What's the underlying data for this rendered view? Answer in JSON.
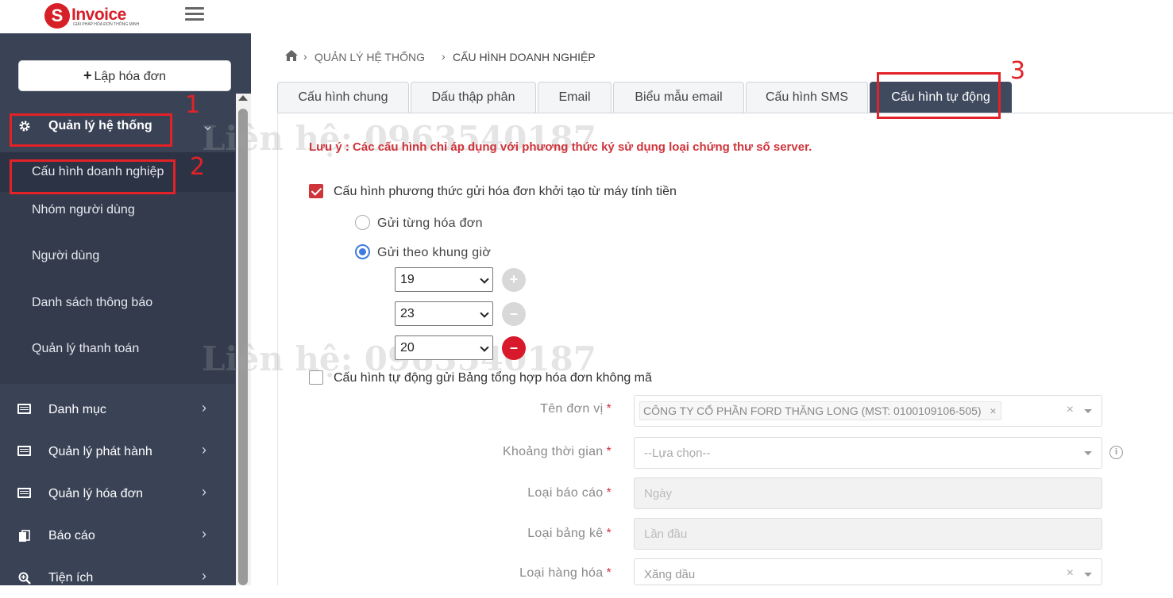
{
  "app": {
    "logo_letter": "S",
    "logo_word": "Invoice",
    "logo_tagline": "GIẢI PHÁP HÓA ĐƠN THÔNG MINH"
  },
  "sidebar": {
    "new_invoice_label": "Lập hóa đơn",
    "system_group": {
      "label": "Quản lý hệ thống",
      "items": [
        {
          "label": "Cấu hình doanh nghiệp"
        },
        {
          "label": "Nhóm người dùng"
        },
        {
          "label": "Người dùng"
        },
        {
          "label": "Danh sách thông báo"
        },
        {
          "label": "Quản lý thanh toán"
        }
      ]
    },
    "groups": [
      {
        "label": "Danh mục"
      },
      {
        "label": "Quản lý phát hành"
      },
      {
        "label": "Quản lý hóa đơn"
      },
      {
        "label": "Báo cáo"
      },
      {
        "label": "Tiện ích"
      }
    ]
  },
  "breadcrumb": {
    "level1": "QUẢN LÝ HỆ THỐNG",
    "level2": "CẤU HÌNH DOANH NGHIỆP"
  },
  "tabs": [
    {
      "label": "Cấu hình chung"
    },
    {
      "label": "Dấu thập phân"
    },
    {
      "label": "Email"
    },
    {
      "label": "Biểu mẫu email"
    },
    {
      "label": "Cấu hình SMS"
    },
    {
      "label": "Cấu hình tự động",
      "active": true
    }
  ],
  "annotations": [
    "1",
    "2",
    "3"
  ],
  "watermark": "Liên hệ: 0963540187",
  "form": {
    "note": "Lưu ý : Các cấu hình chỉ áp dụng với phương thức ký sử dụng loại chứng thư số server.",
    "pos_config_label": "Cấu hình phương thức gửi hóa đơn khởi tạo từ máy tính tiền",
    "pos_config_checked": true,
    "radio_each": "Gửi từng hóa đơn",
    "radio_timeframe": "Gửi theo khung giờ",
    "selected_radio": "timeframe",
    "hours": [
      "19",
      "23",
      "20"
    ],
    "auto_summary_label": "Cấu hình tự động gửi Bảng tổng hợp hóa đơn không mã",
    "auto_summary_checked": false,
    "unit_label": "Tên đơn vị",
    "unit_value": "CÔNG TY CỔ PHẦN FORD THĂNG LONG (MST: 0100109106-505)",
    "period_label": "Khoảng thời gian",
    "period_placeholder": "--Lựa chọn--",
    "report_type_label": "Loại báo cáo",
    "report_type_value": "Ngày",
    "list_type_label": "Loại bảng kê",
    "list_type_value": "Lần đầu",
    "goods_type_label": "Loại hàng hóa",
    "goods_type_value": "Xăng dầu",
    "required_mark": "*"
  },
  "colors": {
    "sidebar_bg": "#3a4356",
    "accent_red": "#d0343b",
    "active_tab": "#3f4a5e",
    "radio_blue": "#3f7be0"
  }
}
